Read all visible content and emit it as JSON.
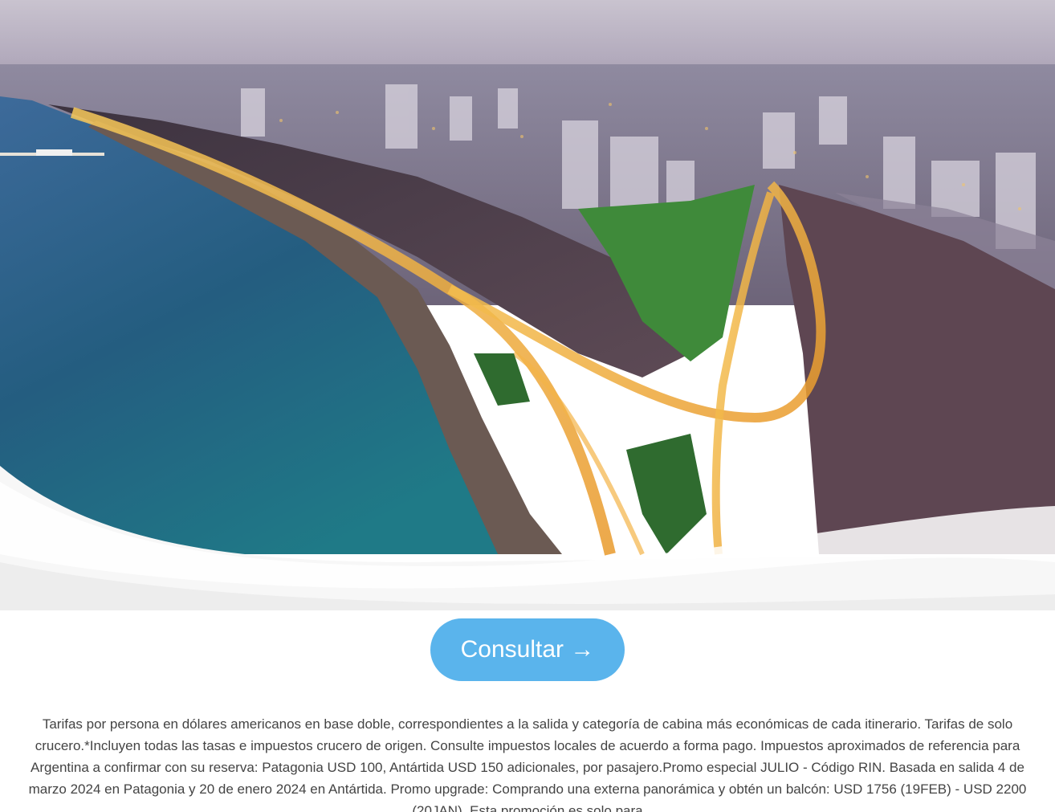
{
  "hero": {
    "image_description_icon": "coastal-city-night-photo"
  },
  "cta": {
    "label": "Consultar →",
    "color": "#5ab4ec"
  },
  "disclaimer": {
    "text": "Tarifas por persona en dólares americanos en base doble, correspondientes a la salida y categoría de cabina más económicas de cada itinerario. Tarifas de solo crucero.*Incluyen todas las tasas e impuestos crucero de origen. Consulte impuestos locales de acuerdo a forma pago. Impuestos aproximados de referencia para Argentina a confirmar con su reserva: Patagonia USD 100, Antártida USD 150 adicionales, por pasajero.Promo especial JULIO - Código RIN. Basada en salida 4 de marzo 2024 en Patagonia y 20 de enero 2024 en Antártida. Promo upgrade: Comprando una externa panorámica y obtén un balcón: USD 1756 (19FEB) - USD 2200 (20JAN). Esta promoción es solo para"
  }
}
